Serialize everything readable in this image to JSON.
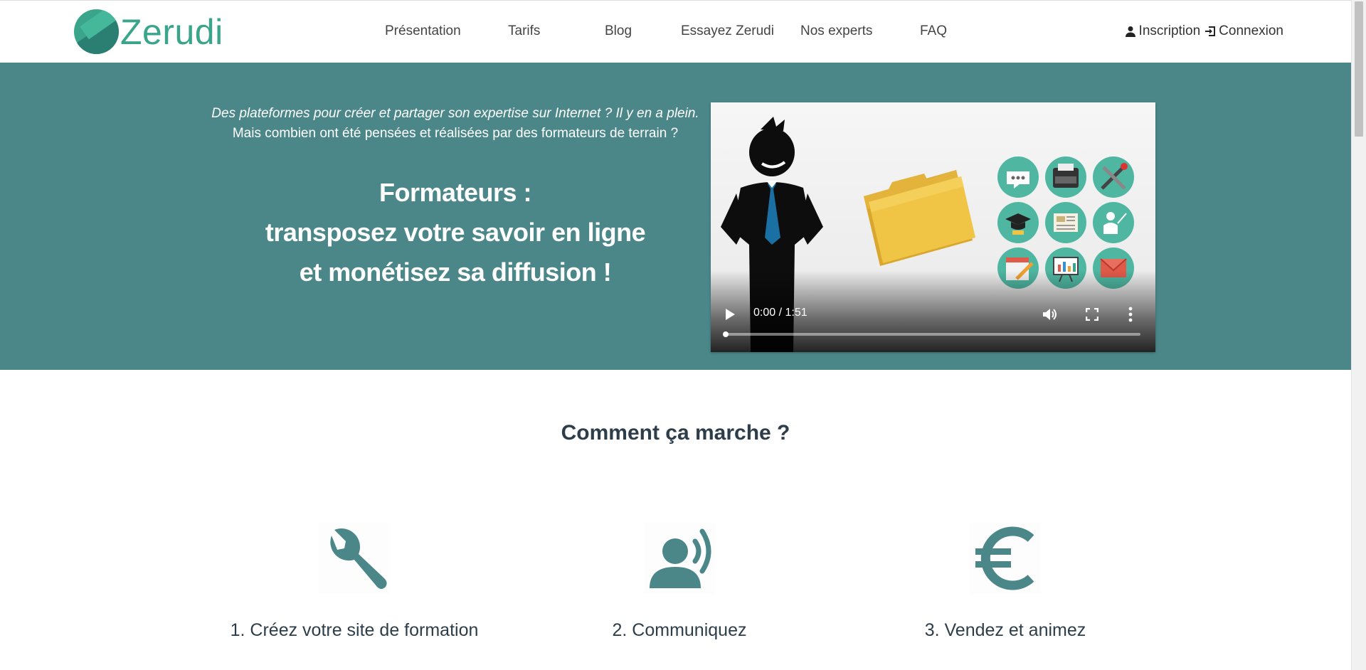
{
  "brand": {
    "name": "Zerudi",
    "color": "#3aa58a"
  },
  "nav": {
    "items": [
      {
        "label": "Présentation"
      },
      {
        "label": "Tarifs"
      },
      {
        "label": "Blog"
      },
      {
        "label": "Essayez Zerudi"
      },
      {
        "label": "Nos experts"
      },
      {
        "label": "FAQ"
      }
    ]
  },
  "auth": {
    "signup_label": "Inscription",
    "login_label": "Connexion",
    "signup_icon": "user-icon",
    "login_icon": "sign-in-icon"
  },
  "hero": {
    "intro_line1": "Des plateformes pour créer et partager son expertise sur Internet ? Il y en a plein.",
    "intro_line2": "Mais combien ont été pensées et réalisées par des formateurs de terrain ?",
    "title_line1": "Formateurs :",
    "title_line2": "transposez votre savoir en ligne",
    "title_line3": "et monétisez sa diffusion !",
    "background_color": "#4b8789"
  },
  "video": {
    "current_time": "0:00",
    "duration": "1:51",
    "time_display": "0:00 / 1:51",
    "progress": 0
  },
  "how_it_works": {
    "title": "Comment ça marche ?",
    "steps": [
      {
        "label": "1. Créez votre site de formation",
        "icon": "wrench-icon"
      },
      {
        "label": "2. Communiquez",
        "icon": "speaking-person-icon"
      },
      {
        "label": "3. Vendez et animez",
        "icon": "euro-icon"
      }
    ],
    "icon_color": "#4b8789"
  }
}
